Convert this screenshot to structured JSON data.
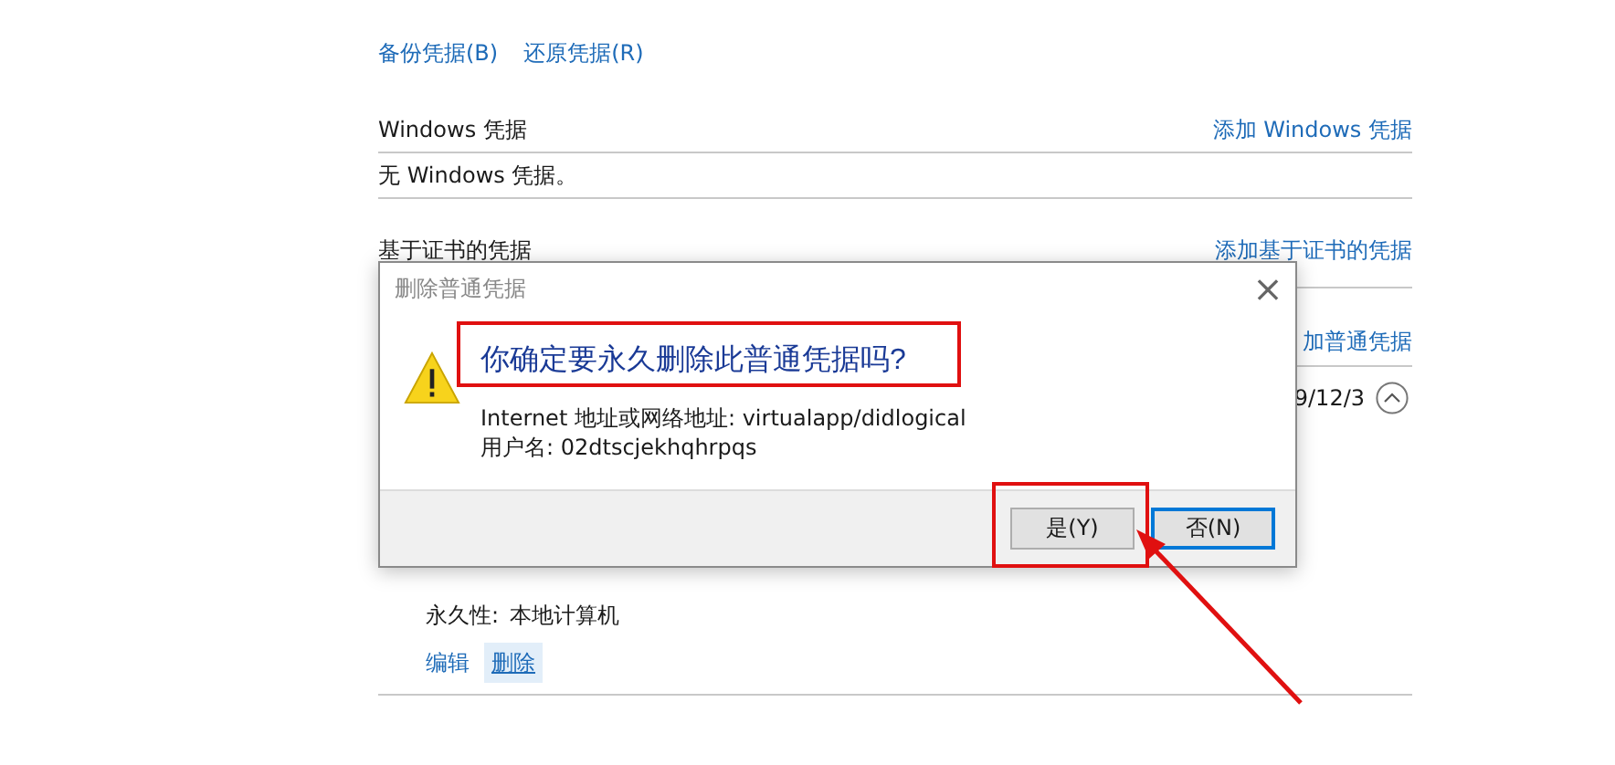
{
  "toolbar_links": [
    {
      "label": "备份凭据(B)"
    },
    {
      "label": "还原凭据(R)"
    }
  ],
  "sections": [
    {
      "kind": "empty",
      "title": "Windows 凭据",
      "action": "添加 Windows 凭据",
      "empty_text": "无 Windows 凭据。"
    },
    {
      "kind": "heading",
      "title": "基于证书的凭据",
      "action": "添加基于证书的凭据"
    },
    {
      "kind": "entries",
      "action": "加普通凭据",
      "entry": {
        "date": "9/12/3",
        "expanded": true,
        "fields": [
          {
            "label": "永久性:",
            "value": "本地计算机"
          }
        ],
        "actions": [
          {
            "label": "编辑",
            "selected": false
          },
          {
            "label": "删除",
            "selected": true
          }
        ]
      }
    }
  ],
  "dialog": {
    "title": "删除普通凭据",
    "close": "×",
    "question": "你确定要永久删除此普通凭据吗?",
    "details": [
      "Internet 地址或网络地址: virtualapp/didlogical",
      "用户名: 02dtscjekhqhrpqs"
    ],
    "buttons": [
      {
        "label": "是(Y)",
        "default": false
      },
      {
        "label": "否(N)",
        "default": true
      }
    ]
  }
}
